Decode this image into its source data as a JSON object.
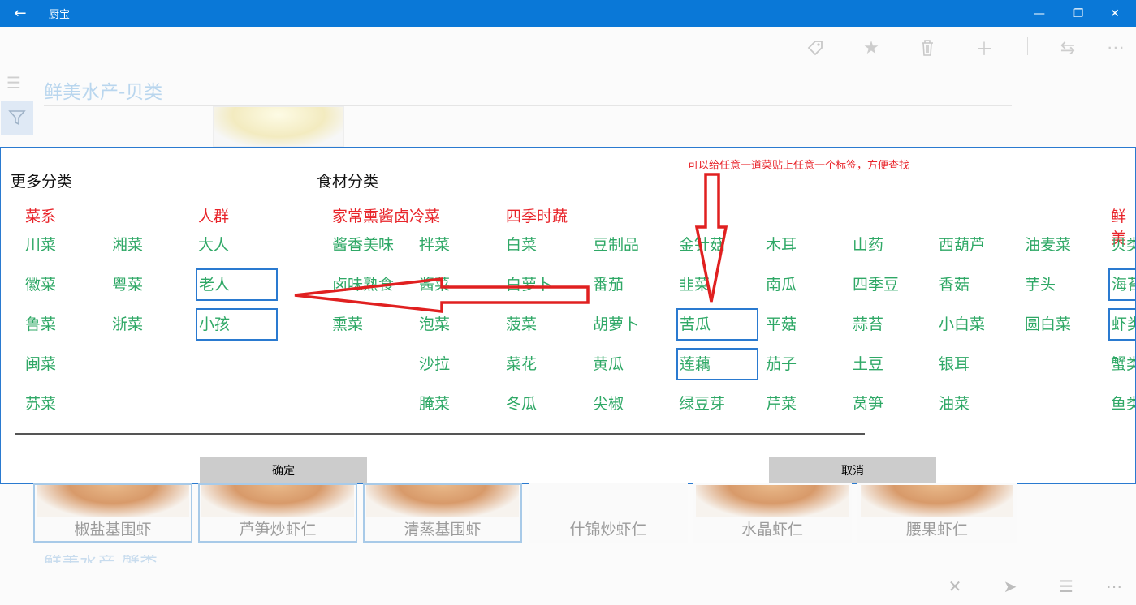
{
  "app": {
    "title": "厨宝"
  },
  "icons": {
    "back": "back-arrow-icon",
    "minimize": "minimize-icon",
    "restore": "restore-icon",
    "close": "close-icon",
    "tag": "tag-icon",
    "star": "star-icon",
    "delete": "trash-icon",
    "add": "plus-icon",
    "swap": "swap-icon",
    "more": "more-icon",
    "menu": "hamburger-icon",
    "filter": "filter-icon",
    "cancel": "x-icon",
    "send": "send-icon",
    "list": "list-icon"
  },
  "page": {
    "title": "鲜美水产-贝类",
    "next_section_title": "鲜美水产-蟹类"
  },
  "dialog": {
    "annotation": "可以给任意一道菜贴上任意一个标签，方便查找",
    "sections": [
      "更多分类",
      "食材分类"
    ],
    "categories": [
      {
        "head": "菜系",
        "items": [
          "川菜",
          "徽菜",
          "鲁菜",
          "闽菜",
          "苏菜"
        ]
      },
      {
        "head": "",
        "items": [
          "湘菜",
          "粤菜",
          "浙菜"
        ]
      },
      {
        "head": "人群",
        "items": [
          "大人",
          "老人",
          "小孩"
        ]
      },
      {
        "head": "家常熏酱卤冷菜",
        "items": [
          "酱香美味",
          "卤味熟食",
          "熏菜"
        ]
      },
      {
        "head": "",
        "items": [
          "拌菜",
          "酱菜",
          "泡菜",
          "沙拉",
          "腌菜"
        ]
      },
      {
        "head": "四季时蔬",
        "items": [
          "白菜",
          "白萝卜",
          "菠菜",
          "菜花",
          "冬瓜"
        ]
      },
      {
        "head": "",
        "items": [
          "豆制品",
          "番茄",
          "胡萝卜",
          "黄瓜",
          "尖椒"
        ]
      },
      {
        "head": "",
        "items": [
          "金针菇",
          "韭菜",
          "苦瓜",
          "莲藕",
          "绿豆芽"
        ]
      },
      {
        "head": "",
        "items": [
          "木耳",
          "南瓜",
          "平菇",
          "茄子",
          "芹菜"
        ]
      },
      {
        "head": "",
        "items": [
          "山药",
          "四季豆",
          "蒜苔",
          "土豆",
          "莴笋"
        ]
      },
      {
        "head": "",
        "items": [
          "西葫芦",
          "香菇",
          "小白菜",
          "银耳",
          "油菜"
        ]
      },
      {
        "head": "",
        "items": [
          "油麦菜",
          "芋头",
          "圆白菜"
        ]
      },
      {
        "head": "鲜美",
        "items": [
          "贝类",
          "海苔",
          "虾类",
          "蟹类",
          "鱼类"
        ]
      }
    ],
    "selected": [
      "老人",
      "小孩",
      "苦瓜",
      "莲藕",
      "海苔",
      "虾类"
    ],
    "confirm_label": "确定",
    "cancel_label": "取消"
  },
  "foods": [
    {
      "name": "椒盐基围虾",
      "framed": true
    },
    {
      "name": "芦笋炒虾仁",
      "framed": true
    },
    {
      "name": "清蒸基围虾",
      "framed": true
    },
    {
      "name": "什锦炒虾仁",
      "framed": false
    },
    {
      "name": "水晶虾仁",
      "framed": false
    },
    {
      "name": "腰果虾仁",
      "framed": false
    }
  ]
}
